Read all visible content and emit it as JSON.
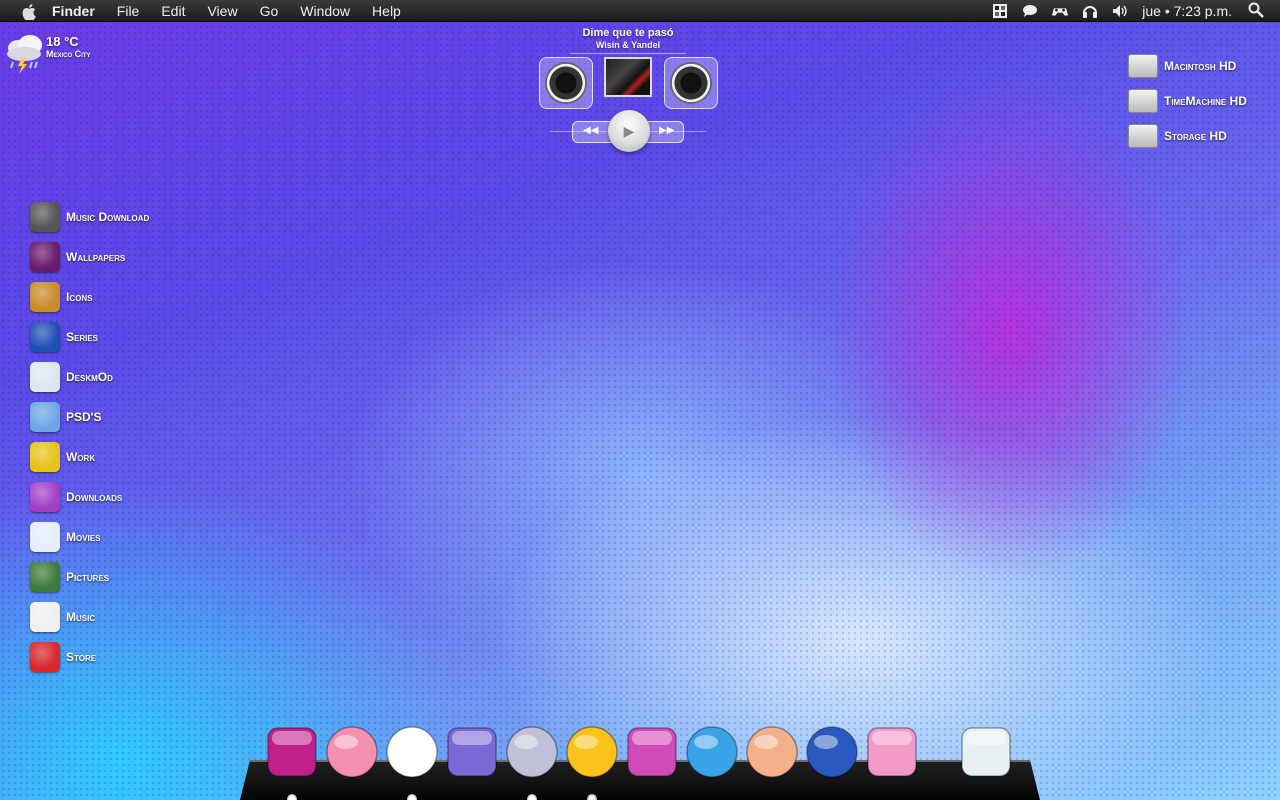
{
  "menubar": {
    "app_name": "Finder",
    "items": [
      "File",
      "Edit",
      "View",
      "Go",
      "Window",
      "Help"
    ],
    "clock": "jue • 7:23 p.m."
  },
  "weather": {
    "temperature": "18 °C",
    "city": "Mexico City"
  },
  "player": {
    "song": "Dime que te pasó",
    "artist": "Wisin & Yandel"
  },
  "drives": [
    {
      "label": "Macintosh HD"
    },
    {
      "label": "TimeMachine HD"
    },
    {
      "label": "Storage HD"
    }
  ],
  "desktop_folders": [
    {
      "label": "Music Download",
      "icon": "radio-icon",
      "color": "#555555"
    },
    {
      "label": "Wallpapers",
      "icon": "tv-icon",
      "color": "#6a1a6a"
    },
    {
      "label": "Icons",
      "icon": "medal-icon",
      "color": "#c98a2a"
    },
    {
      "label": "Series",
      "icon": "superman-icon",
      "color": "#1f4fb5"
    },
    {
      "label": "DeskmOd",
      "icon": "calendar-icon",
      "color": "#dfe6f0"
    },
    {
      "label": "PSD'S",
      "icon": "store-icon",
      "color": "#6aa7e6"
    },
    {
      "label": "Work",
      "icon": "barrier-icon",
      "color": "#e7c21a"
    },
    {
      "label": "Downloads",
      "icon": "gift-icon",
      "color": "#a33fc7"
    },
    {
      "label": "Movies",
      "icon": "ghost-icon",
      "color": "#e6eefb"
    },
    {
      "label": "Pictures",
      "icon": "chip-icon",
      "color": "#3f7a3a"
    },
    {
      "label": "Music",
      "icon": "compass-icon",
      "color": "#f0f0f0"
    },
    {
      "label": "Store",
      "icon": "sofa-icon",
      "color": "#d8282a"
    }
  ],
  "dock": [
    {
      "name": "monster-icon",
      "color": "#c0208a",
      "running": true
    },
    {
      "name": "pig-icon",
      "color": "#f58fb0",
      "running": false
    },
    {
      "name": "soccer-ball-icon",
      "color": "#ffffff",
      "running": true
    },
    {
      "name": "robot-speaker-icon",
      "color": "#7a6ad8",
      "running": false
    },
    {
      "name": "cd-heart-icon",
      "color": "#c0c0d8",
      "running": true
    },
    {
      "name": "rubber-duck-icon",
      "color": "#f8c21a",
      "running": true
    },
    {
      "name": "paint-brush-icon",
      "color": "#d04ab8",
      "running": false
    },
    {
      "name": "twitter-bird-icon",
      "color": "#3aa3e8",
      "running": false
    },
    {
      "name": "girl-face-icon",
      "color": "#f4b08a",
      "running": false
    },
    {
      "name": "pepsi-cd-icon",
      "color": "#2a5ac0",
      "running": false
    },
    {
      "name": "milkshake-icon",
      "color": "#f29ac8",
      "running": false
    },
    {
      "name": "glass-trash-icon",
      "color": "#e8f0f4",
      "running": false
    }
  ]
}
